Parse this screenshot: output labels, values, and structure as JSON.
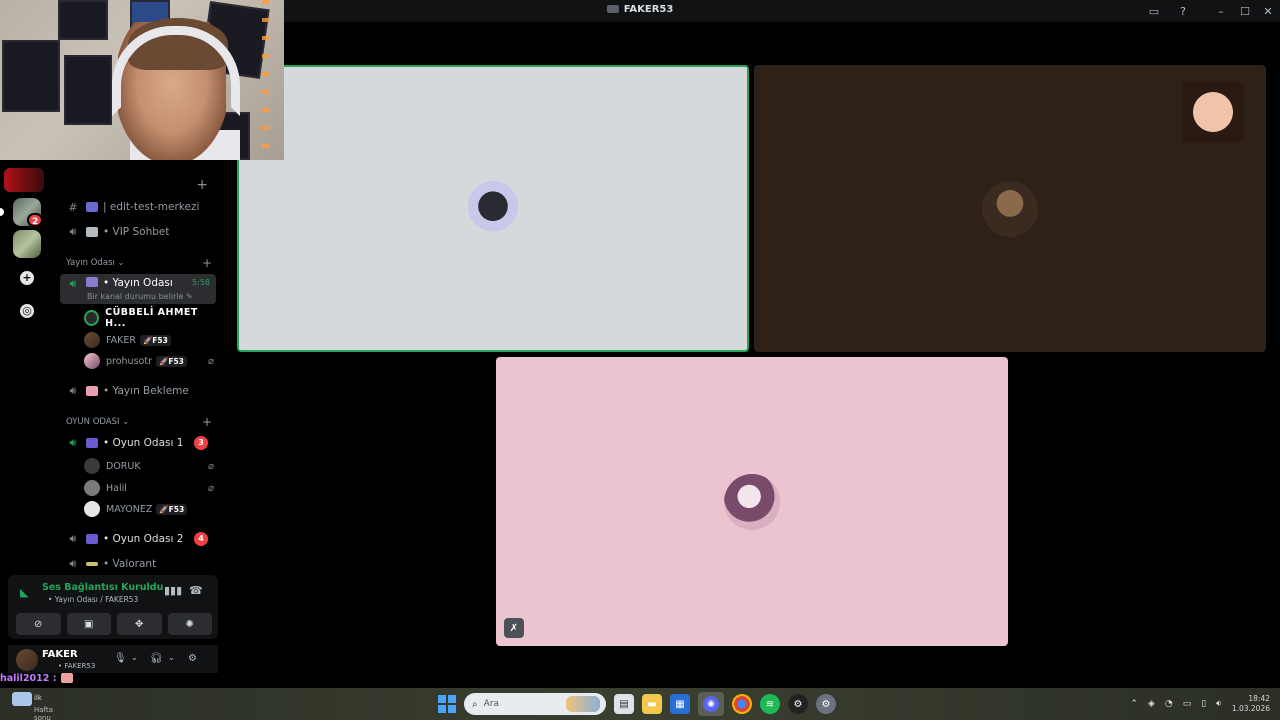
{
  "window": {
    "title": "FAKER53",
    "buttons": [
      "inbox-icon",
      "help-icon",
      "minimize-icon",
      "maximize-icon",
      "close-icon"
    ]
  },
  "rail": {
    "server_badge": "2"
  },
  "sidebar": {
    "server_name": "",
    "channels_top": [
      {
        "icon": "hash-icon",
        "label": "| edit-test-merkezi"
      },
      {
        "icon": "speaker-icon",
        "label": "• VIP Sohbet"
      }
    ],
    "category_yayin": "Yayın Odası ⌄",
    "yayin_channel": {
      "label": "• Yayın Odası",
      "status": "Bir kanal durumu belirle ✎",
      "timer": "5:58"
    },
    "yayin_users": [
      {
        "name": "CÜBBELİ AHMET H...",
        "tag": "",
        "muted": false
      },
      {
        "name": "FAKER",
        "tag": "🚀F53",
        "muted": false
      },
      {
        "name": "prohusotr",
        "tag": "🚀F53",
        "muted": true
      }
    ],
    "bekleme": "• Yayın Bekleme",
    "category_oyun": "OYUN ODASI ⌄",
    "oyun1": {
      "label": "• Oyun Odası 1",
      "count": "3"
    },
    "oyun1_users": [
      {
        "name": "DORUK",
        "tag": "",
        "muted": true
      },
      {
        "name": "Halil",
        "tag": "",
        "muted": true
      },
      {
        "name": "MAYONEZ",
        "tag": "🚀F53",
        "muted": false
      }
    ],
    "oyun2": {
      "label": "• Oyun Odası 2",
      "count": "4"
    },
    "valorant": "• Valorant"
  },
  "voice": {
    "status": "Ses Bağlantısı Kuruldu",
    "sub": "• Yayın Odası / FAKER53"
  },
  "user": {
    "name": "FAKER",
    "sub": "• FAKER53"
  },
  "chat": {
    "line": "halil2012 :"
  },
  "taskbar": {
    "weather_top": "ilk",
    "weather_bottom": "Hafta sonu",
    "search_placeholder": "Ara",
    "time": "18:42",
    "date": "1.03.2026"
  }
}
